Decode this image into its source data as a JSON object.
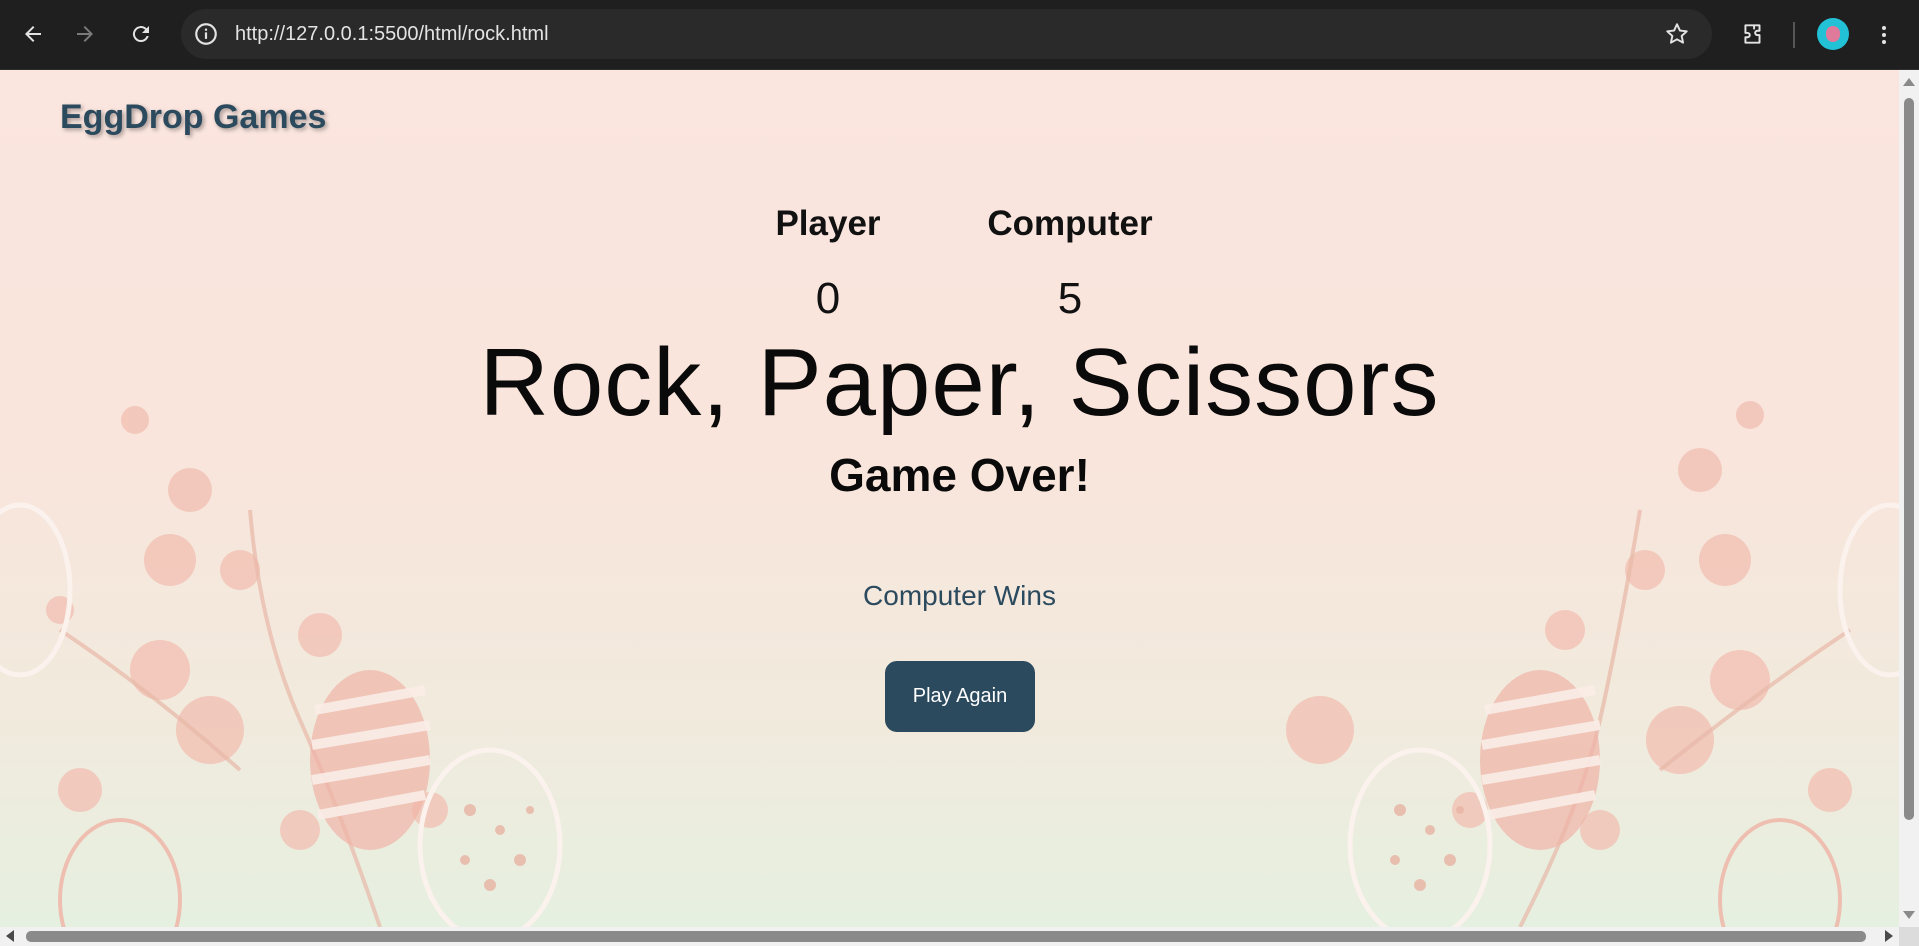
{
  "browser": {
    "url": "http://127.0.0.1:5500/html/rock.html",
    "icons": [
      "back-arrow-icon",
      "forward-arrow-icon",
      "reload-icon",
      "info-icon",
      "star-icon",
      "extensions-icon",
      "profile-avatar",
      "kebab-menu-icon"
    ]
  },
  "page": {
    "brand": "EggDrop Games",
    "scoreboard": {
      "player_label": "Player",
      "player_score": "0",
      "computer_label": "Computer",
      "computer_score": "5"
    },
    "title": "Rock, Paper, Scissors",
    "status": "Game Over!",
    "result": "Computer Wins",
    "play_again_label": "Play Again"
  },
  "colors": {
    "brand": "#2b4a5e",
    "button_bg": "#2b4a5e",
    "chrome_bg": "#1f1f1f"
  }
}
